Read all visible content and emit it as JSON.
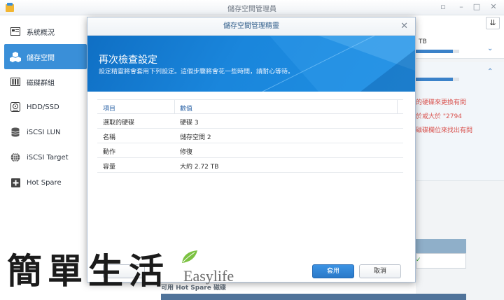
{
  "window": {
    "title": "儲存空間管理員"
  },
  "sidebar": {
    "items": [
      {
        "label": "系統概況",
        "icon": "overview-icon"
      },
      {
        "label": "儲存空間",
        "icon": "storage-cubes-icon",
        "active": true
      },
      {
        "label": "磁碟群組",
        "icon": "disk-group-icon"
      },
      {
        "label": "HDD/SSD",
        "icon": "hdd-icon"
      },
      {
        "label": "iSCSI LUN",
        "icon": "database-icon"
      },
      {
        "label": "iSCSI Target",
        "icon": "globe-icon"
      },
      {
        "label": "Hot Spare",
        "icon": "hot-spare-icon"
      }
    ]
  },
  "background": {
    "volume_size": "TB",
    "usage_1": 0.85,
    "usage_2": 0.85,
    "warning_lines": [
      "的硬碟來更換有問",
      "於或大於 \"2794",
      "磁碟欄位來找出有問"
    ],
    "hot_spare_section": "可用 Hot Spare 磁碟"
  },
  "modal": {
    "title": "儲存空間管理精靈",
    "banner_title": "再次檢查設定",
    "banner_subtitle": "設定精靈將會套用下列設定。這個步驟將會花一些時間，請耐心等待。",
    "columns": [
      "項目",
      "數值"
    ],
    "rows": [
      {
        "item": "選取的硬碟",
        "value": "硬碟 3"
      },
      {
        "item": "名稱",
        "value": "儲存空間 2"
      },
      {
        "item": "動作",
        "value": "修復"
      },
      {
        "item": "容量",
        "value": "大約 2.72 TB"
      }
    ],
    "apply_label": "套用",
    "cancel_label": "取消"
  },
  "watermark": {
    "cjk": "簡單生活",
    "latin": "Easylife"
  },
  "colors": {
    "accent": "#3a8fd8",
    "banner": "#1a86dc",
    "warning": "#d9534f"
  }
}
